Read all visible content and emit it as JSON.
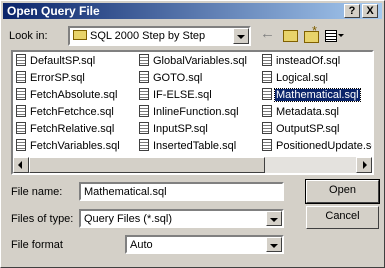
{
  "dialog": {
    "title": "Open Query File",
    "help_glyph": "?",
    "close_glyph": "X"
  },
  "look_in": {
    "label": "Look in:",
    "value": "SQL 2000 Step by Step"
  },
  "toolbar": {
    "icons": [
      "back-arrow-icon",
      "up-one-level-icon",
      "new-folder-icon",
      "view-menu-icon"
    ]
  },
  "files": {
    "col1": [
      "DefaultSP.sql",
      "ErrorSP.sql",
      "FetchAbsolute.sql",
      "FetchFetchce.sql",
      "FetchRelative.sql",
      "FetchVariables.sql"
    ],
    "col2": [
      "GlobalVariables.sql",
      "GOTO.sql",
      "IF-ELSE.sql",
      "InlineFunction.sql",
      "InputSP.sql",
      "InsertedTable.sql"
    ],
    "col3": [
      "insteadOf.sql",
      "Logical.sql",
      "Mathematical.sql",
      "Metadata.sql",
      "OutputSP.sql",
      "PositionedUpdate.sql"
    ],
    "selected": "Mathematical.sql"
  },
  "form": {
    "file_name_label": "File name:",
    "file_name_value": "Mathematical.sql",
    "files_of_type_label": "Files of type:",
    "files_of_type_value": "Query Files (*.sql)",
    "file_format_label": "File format",
    "file_format_value": "Auto"
  },
  "buttons": {
    "open": "Open",
    "cancel": "Cancel"
  },
  "colors": {
    "title_start": "#0a246a",
    "title_end": "#a6caf0",
    "face": "#d4d0c8",
    "selection": "#0a246a"
  }
}
